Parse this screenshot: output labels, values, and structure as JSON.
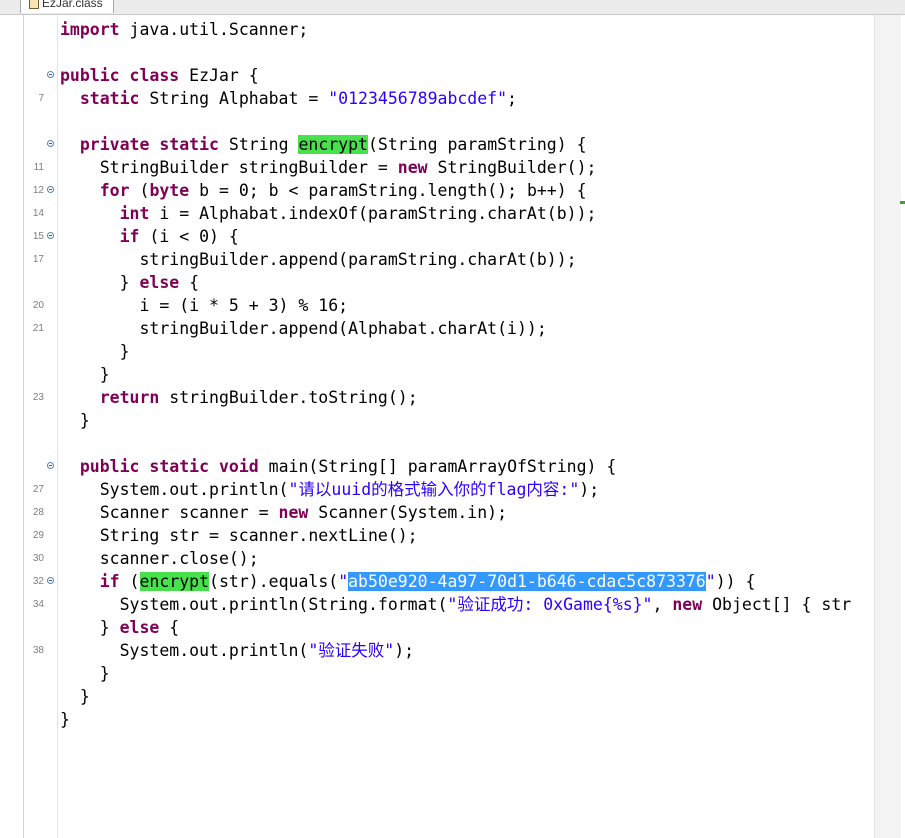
{
  "tab": {
    "title": "EzJar.class",
    "icon": "class-file-icon"
  },
  "colors": {
    "keyword": "#7f0055",
    "string": "#2a00ff",
    "occurrence_highlight": "#48e04b",
    "selection": "#3399ff"
  },
  "lines": [
    {
      "ln": "",
      "fold": false,
      "tokens": [
        {
          "t": "import",
          "c": "kw"
        },
        {
          "t": " java.util.Scanner;"
        }
      ]
    },
    {
      "ln": "",
      "fold": false,
      "tokens": []
    },
    {
      "ln": "",
      "fold": true,
      "tokens": [
        {
          "t": "public",
          "c": "kw"
        },
        {
          "t": " "
        },
        {
          "t": "class",
          "c": "kw"
        },
        {
          "t": " EzJar {"
        }
      ]
    },
    {
      "ln": "7",
      "fold": false,
      "tokens": [
        {
          "t": "  "
        },
        {
          "t": "static",
          "c": "kw"
        },
        {
          "t": " String Alphabat = "
        },
        {
          "t": "\"0123456789abcdef\"",
          "c": "str"
        },
        {
          "t": ";"
        }
      ]
    },
    {
      "ln": "",
      "fold": false,
      "tokens": []
    },
    {
      "ln": "",
      "fold": true,
      "tokens": [
        {
          "t": "  "
        },
        {
          "t": "private",
          "c": "kw"
        },
        {
          "t": " "
        },
        {
          "t": "static",
          "c": "kw"
        },
        {
          "t": " String "
        },
        {
          "t": "encrypt",
          "c": "hl-green"
        },
        {
          "t": "(String paramString) {"
        }
      ]
    },
    {
      "ln": "11",
      "fold": false,
      "tokens": [
        {
          "t": "    StringBuilder stringBuilder = "
        },
        {
          "t": "new",
          "c": "kw"
        },
        {
          "t": " StringBuilder();"
        }
      ]
    },
    {
      "ln": "12",
      "fold": true,
      "tokens": [
        {
          "t": "    "
        },
        {
          "t": "for",
          "c": "kw"
        },
        {
          "t": " ("
        },
        {
          "t": "byte",
          "c": "kw"
        },
        {
          "t": " b = 0; b < paramString.length(); b++) {"
        }
      ]
    },
    {
      "ln": "14",
      "fold": false,
      "tokens": [
        {
          "t": "      "
        },
        {
          "t": "int",
          "c": "kw"
        },
        {
          "t": " i = Alphabat.indexOf(paramString.charAt(b));"
        }
      ]
    },
    {
      "ln": "15",
      "fold": true,
      "tokens": [
        {
          "t": "      "
        },
        {
          "t": "if",
          "c": "kw"
        },
        {
          "t": " (i < 0) {"
        }
      ]
    },
    {
      "ln": "17",
      "fold": false,
      "tokens": [
        {
          "t": "        stringBuilder.append(paramString.charAt(b));"
        }
      ]
    },
    {
      "ln": "",
      "fold": false,
      "tokens": [
        {
          "t": "      } "
        },
        {
          "t": "else",
          "c": "kw"
        },
        {
          "t": " {"
        }
      ]
    },
    {
      "ln": "20",
      "fold": false,
      "tokens": [
        {
          "t": "        i = (i * 5 + 3) % 16;"
        }
      ]
    },
    {
      "ln": "21",
      "fold": false,
      "tokens": [
        {
          "t": "        stringBuilder.append(Alphabat.charAt(i));"
        }
      ]
    },
    {
      "ln": "",
      "fold": false,
      "tokens": [
        {
          "t": "      }"
        }
      ]
    },
    {
      "ln": "",
      "fold": false,
      "tokens": [
        {
          "t": "    }"
        }
      ]
    },
    {
      "ln": "23",
      "fold": false,
      "tokens": [
        {
          "t": "    "
        },
        {
          "t": "return",
          "c": "kw"
        },
        {
          "t": " stringBuilder.toString();"
        }
      ]
    },
    {
      "ln": "",
      "fold": false,
      "tokens": [
        {
          "t": "  }"
        }
      ]
    },
    {
      "ln": "",
      "fold": false,
      "tokens": []
    },
    {
      "ln": "",
      "fold": true,
      "tokens": [
        {
          "t": "  "
        },
        {
          "t": "public",
          "c": "kw"
        },
        {
          "t": " "
        },
        {
          "t": "static",
          "c": "kw"
        },
        {
          "t": " "
        },
        {
          "t": "void",
          "c": "kw"
        },
        {
          "t": " main(String[] paramArrayOfString) {"
        }
      ]
    },
    {
      "ln": "27",
      "fold": false,
      "tokens": [
        {
          "t": "    System.out.println("
        },
        {
          "t": "\"请以uuid的格式输入你的flag内容:\"",
          "c": "str"
        },
        {
          "t": ");"
        }
      ]
    },
    {
      "ln": "28",
      "fold": false,
      "tokens": [
        {
          "t": "    Scanner scanner = "
        },
        {
          "t": "new",
          "c": "kw"
        },
        {
          "t": " Scanner(System.in);"
        }
      ]
    },
    {
      "ln": "29",
      "fold": false,
      "tokens": [
        {
          "t": "    String str = scanner.nextLine();"
        }
      ]
    },
    {
      "ln": "30",
      "fold": false,
      "tokens": [
        {
          "t": "    scanner.close();"
        }
      ]
    },
    {
      "ln": "32",
      "fold": true,
      "tokens": [
        {
          "t": "    "
        },
        {
          "t": "if",
          "c": "kw"
        },
        {
          "t": " ("
        },
        {
          "t": "encrypt",
          "c": "hl-green"
        },
        {
          "t": "(str).equals("
        },
        {
          "t": "\"",
          "c": "str"
        },
        {
          "t": "ab50e920-4a97-70d1-b646-cdac5c873376",
          "c": "hl-sel"
        },
        {
          "t": "\"",
          "c": "str"
        },
        {
          "t": ")) {"
        }
      ]
    },
    {
      "ln": "34",
      "fold": false,
      "tokens": [
        {
          "t": "      System.out.println(String.format("
        },
        {
          "t": "\"验证成功: 0xGame{%s}\"",
          "c": "str"
        },
        {
          "t": ", "
        },
        {
          "t": "new",
          "c": "kw"
        },
        {
          "t": " Object[] { str"
        }
      ]
    },
    {
      "ln": "",
      "fold": false,
      "tokens": [
        {
          "t": "    } "
        },
        {
          "t": "else",
          "c": "kw"
        },
        {
          "t": " {"
        }
      ]
    },
    {
      "ln": "38",
      "fold": false,
      "tokens": [
        {
          "t": "      System.out.println("
        },
        {
          "t": "\"验证失败\"",
          "c": "str"
        },
        {
          "t": ");"
        }
      ]
    },
    {
      "ln": "",
      "fold": false,
      "tokens": [
        {
          "t": "    }"
        }
      ]
    },
    {
      "ln": "",
      "fold": false,
      "tokens": [
        {
          "t": "  }"
        }
      ]
    },
    {
      "ln": "",
      "fold": false,
      "tokens": [
        {
          "t": "}"
        }
      ]
    }
  ]
}
